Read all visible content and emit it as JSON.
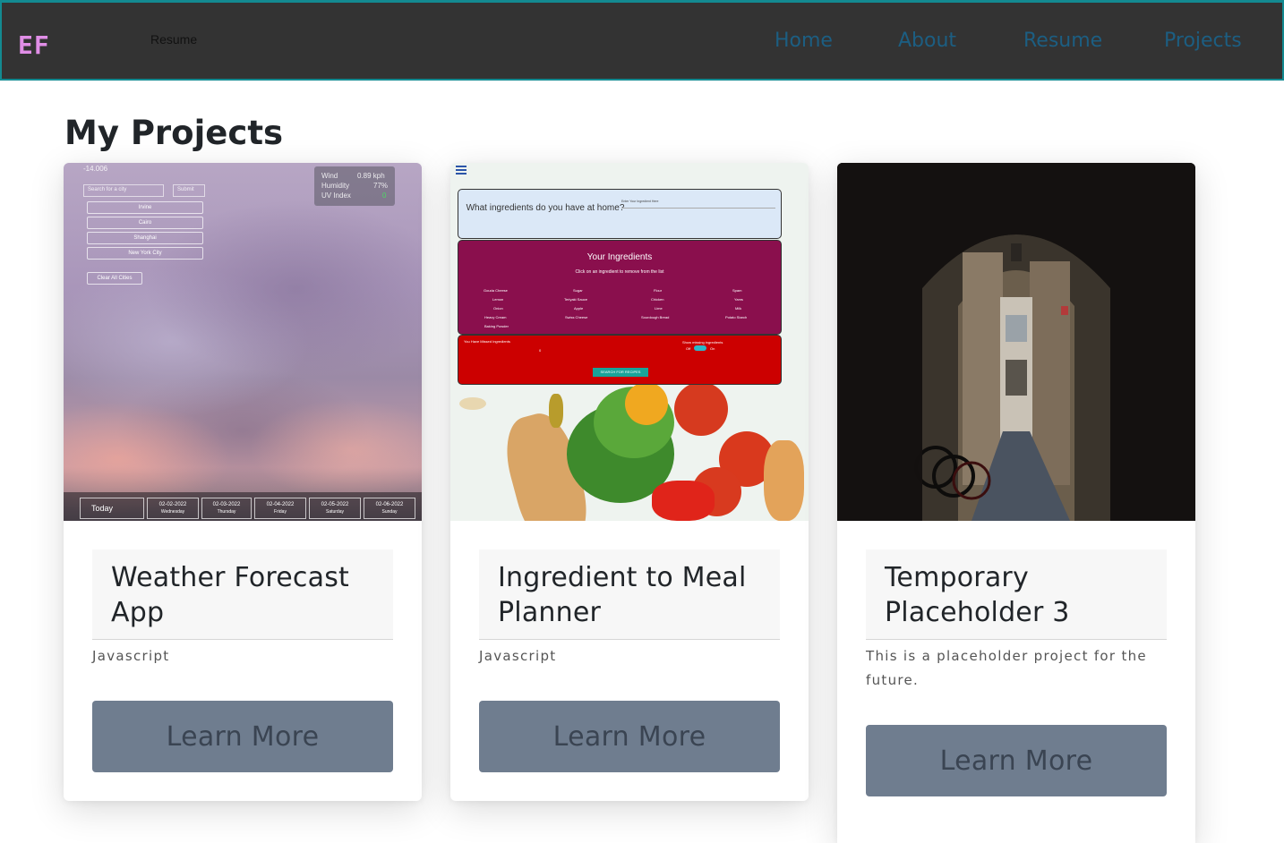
{
  "nav": {
    "brand": "EF",
    "floating_label": "Resume",
    "links": [
      {
        "label": "Home"
      },
      {
        "label": "About"
      },
      {
        "label": "Resume"
      },
      {
        "label": "Projects"
      }
    ]
  },
  "main": {
    "title": "My Projects",
    "cards": [
      {
        "title": "Weather Forecast App",
        "text": "Javascript",
        "button": "Learn More",
        "thumbnail": {
          "subtitle": "-14.006",
          "search_placeholder": "Search for a city",
          "submit": "Submit",
          "cities": [
            "Irvine",
            "Cairo",
            "Shanghai",
            "New York City"
          ],
          "clear": "Clear All Cities",
          "info": [
            {
              "label": "Wind",
              "value": "0.89 kph"
            },
            {
              "label": "Humidity",
              "value": "77%"
            },
            {
              "label": "UV Index",
              "value": "0"
            }
          ],
          "forecast": [
            {
              "date": "Today",
              "day": ""
            },
            {
              "date": "02-02-2022",
              "day": "Wednesday"
            },
            {
              "date": "02-03-2022",
              "day": "Thursday"
            },
            {
              "date": "02-04-2022",
              "day": "Friday"
            },
            {
              "date": "02-05-2022",
              "day": "Saturday"
            },
            {
              "date": "02-06-2022",
              "day": "Sunday"
            }
          ]
        }
      },
      {
        "title": "Ingredient to Meal Planner",
        "text": "Javascript",
        "button": "Learn More",
        "thumbnail": {
          "question": "What ingredients do you have at home?",
          "input_placeholder": "Enter Your Ingredient Here",
          "panel_title": "Your Ingredients",
          "panel_hint": "Click on an ingredient to remove from the list",
          "ingredients": [
            "Gouda Cheese",
            "Sugar",
            "Flour",
            "Spam",
            "Lemon",
            "Teriyaki Sauce",
            "Chicken",
            "Yams",
            "Onion",
            "Apple",
            "Lime",
            "Milk",
            "Heavy Cream",
            "Swiss Cheese",
            "Sourdough Bread",
            "Potato Starch",
            "Baking Powder"
          ],
          "red_left": "You Have Missed Ingredients",
          "red_zero": "0",
          "red_right": "Show missing ingredients",
          "red_off": "Off",
          "red_on": "On",
          "search_button": "SEARCH FOR RECIPES"
        }
      },
      {
        "title": "Temporary Placeholder 3",
        "text": "This is a placeholder project for the future.",
        "button": "Learn More",
        "thumbnail": {}
      }
    ]
  },
  "colors": {
    "nav_bg": "#333333",
    "nav_border": "#138a91",
    "brand": "#e08ee6",
    "nav_link": "#1c5e82",
    "button_bg": "#6f7d8f",
    "meal_panel_purple": "#8a0f4d",
    "meal_panel_red": "#cc0000"
  },
  "icons": [
    "hamburger-menu-icon"
  ]
}
